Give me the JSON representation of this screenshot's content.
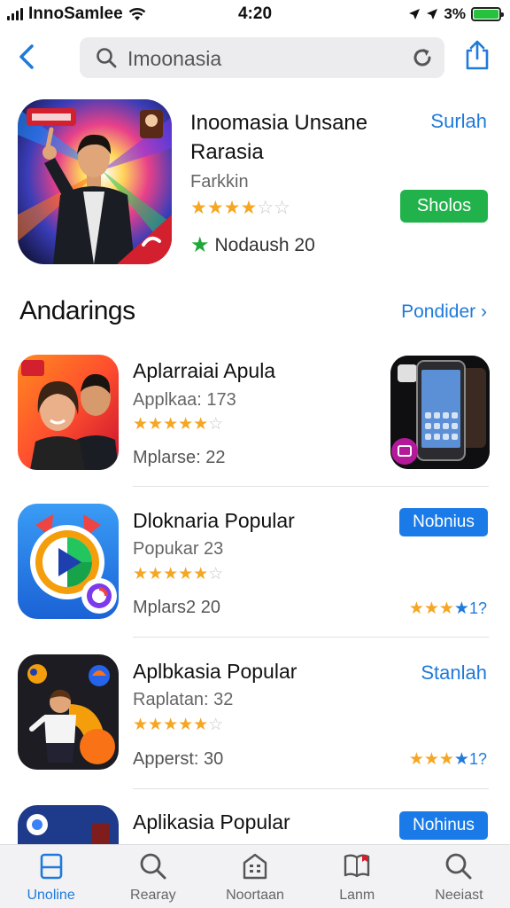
{
  "status_bar": {
    "carrier": "InnoSamlee",
    "time": "4:20",
    "battery": "3%"
  },
  "nav": {
    "search_value": "Imoonasia",
    "icons": [
      "chevron-left-icon",
      "search-icon",
      "reload-icon",
      "share-icon"
    ]
  },
  "featured": {
    "title": "Inoomasia Unsane Rarasia",
    "developer": "Farkkin",
    "rating": 3.5,
    "award_text": "Nodaush 20",
    "link": "Surlah",
    "button": "Sholos"
  },
  "section": {
    "title": "Andarings",
    "link": "Pondider"
  },
  "apps": [
    {
      "title": "Aplarraiai Apula",
      "subtitle": "Applkaa: 173",
      "rating": 4.5,
      "meta": "Mplarse: 22"
    },
    {
      "title": "Dloknaria Popular",
      "subtitle": "Popukar 23",
      "rating": 4.5,
      "meta": "Mplars2 20",
      "button": "Nobnius",
      "side_rating_count": "1?"
    },
    {
      "title": "Aplbkasia Popular",
      "subtitle": "Raplatan: 32",
      "rating": 4.5,
      "meta": "Apperst: 30",
      "link": "Stanlah",
      "side_rating_count": "1?"
    },
    {
      "title": "Aplikasia Popular",
      "button": "Nohinus"
    }
  ],
  "tabs": [
    {
      "label": "Unoline",
      "icon": "square-icon",
      "active": true
    },
    {
      "label": "Rearay",
      "icon": "search-icon",
      "active": false
    },
    {
      "label": "Noortaan",
      "icon": "building-icon",
      "active": false
    },
    {
      "label": "Lanm",
      "icon": "book-icon",
      "active": false
    },
    {
      "label": "Neeiast",
      "icon": "search-icon",
      "active": false
    }
  ],
  "colors": {
    "accent_blue": "#1f7adb",
    "button_blue": "#1a7be8",
    "button_green": "#22b24c",
    "star": "#f5a623",
    "battery_green": "#27c23d"
  }
}
